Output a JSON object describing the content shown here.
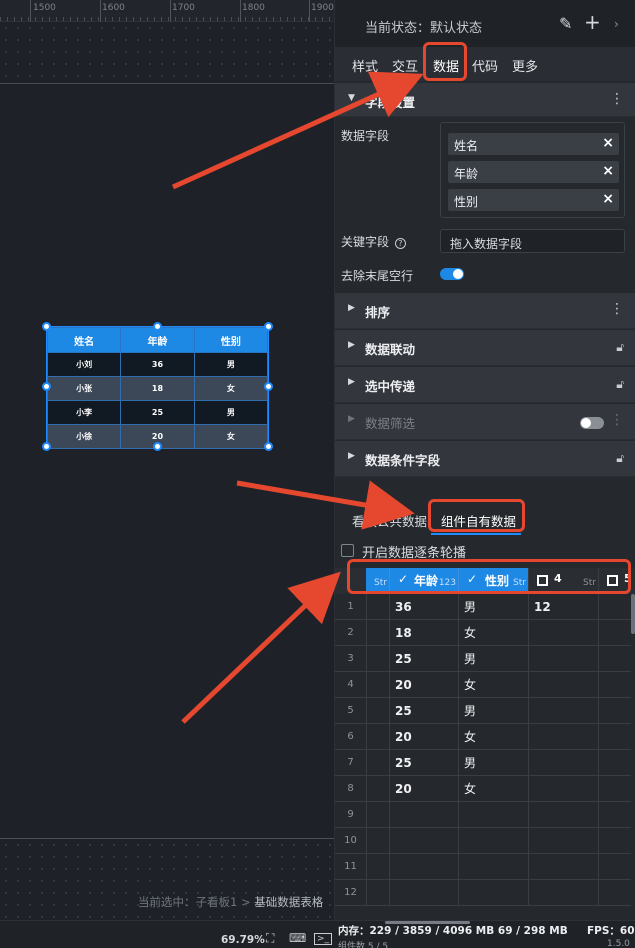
{
  "ruler": {
    "ticks": [
      "1500",
      "1600",
      "1700",
      "1800",
      "1900"
    ]
  },
  "widget_table": {
    "headers": [
      "姓名",
      "年龄",
      "性别"
    ],
    "rows": [
      [
        "小刘",
        "36",
        "男"
      ],
      [
        "小张",
        "18",
        "女"
      ],
      [
        "小李",
        "25",
        "男"
      ],
      [
        "小徐",
        "20",
        "女"
      ]
    ]
  },
  "selection_path": {
    "prefix": "当前选中：子看板1 > ",
    "current": "基础数据表格"
  },
  "state_bar": {
    "label": "当前状态：默认状态",
    "icons": [
      "edit-icon",
      "plus-icon",
      "chevron-right-icon"
    ]
  },
  "tabs": [
    "样式",
    "交互",
    "数据",
    "代码",
    "更多"
  ],
  "active_tab": "数据",
  "field_section": {
    "title": "字段设置",
    "data_fields_label": "数据字段",
    "fields": [
      "姓名",
      "年龄",
      "性别"
    ],
    "key_field_label": "关键字段",
    "key_field_placeholder": "拖入数据字段",
    "trim_label": "去除末尾空行",
    "trim_enabled": true
  },
  "sections": [
    {
      "title": "排序",
      "right": "more",
      "dim": false
    },
    {
      "title": "数据联动",
      "right": "lock",
      "dim": false
    },
    {
      "title": "选中传递",
      "right": "lock",
      "dim": false
    },
    {
      "title": "数据筛选",
      "right": "toggle-more",
      "dim": true
    },
    {
      "title": "数据条件字段",
      "right": "lock",
      "dim": false
    }
  ],
  "lower_tabs": [
    "看板公共数据",
    "组件自有数据"
  ],
  "active_lower_tab": "组件自有数据",
  "carousel_label": "开启数据逐条轮播",
  "grid": {
    "columns": [
      {
        "name": "",
        "type": "Str",
        "checked": false,
        "selected": true
      },
      {
        "name": "年龄",
        "type": "123",
        "checked": true,
        "selected": true
      },
      {
        "name": "性别",
        "type": "Str",
        "checked": true,
        "selected": true
      },
      {
        "name": "4",
        "type": "Str",
        "checked": false,
        "selected": false
      },
      {
        "name": "5",
        "type": "",
        "checked": false,
        "selected": false
      }
    ],
    "row_numbers": [
      "1",
      "2",
      "3",
      "4",
      "5",
      "6",
      "7",
      "8",
      "9",
      "10",
      "11",
      "12"
    ],
    "rows": [
      [
        "36",
        "男",
        "12"
      ],
      [
        "18",
        "女",
        ""
      ],
      [
        "25",
        "男",
        ""
      ],
      [
        "20",
        "女",
        ""
      ],
      [
        "25",
        "男",
        ""
      ],
      [
        "20",
        "女",
        ""
      ],
      [
        "25",
        "男",
        ""
      ],
      [
        "20",
        "女",
        ""
      ],
      [
        "",
        "",
        ""
      ],
      [
        "",
        "",
        ""
      ],
      [
        "",
        "",
        ""
      ],
      [
        "",
        "",
        ""
      ]
    ]
  },
  "status": {
    "zoom": "69.79%",
    "memory": "内存：229 / 3859 / 4096 MB  69 / 298 MB",
    "fps": "FPS：60",
    "sub": "组件数 5 / 5",
    "sub_right": "1.5.0"
  },
  "colors": {
    "accent": "#1e88e5",
    "annotation": "#e5482f",
    "panel": "#25282d"
  }
}
